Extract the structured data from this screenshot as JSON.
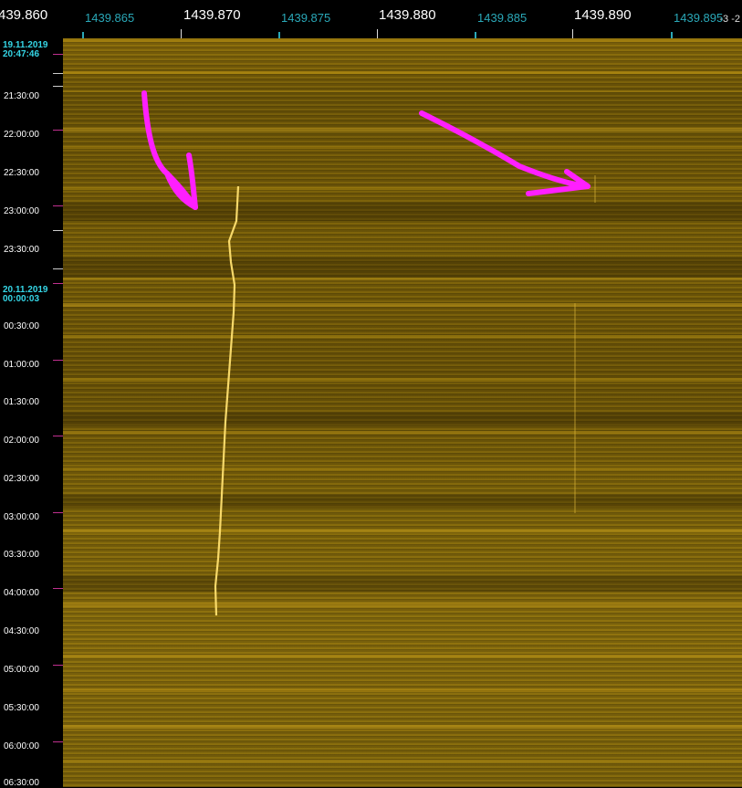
{
  "freq_axis": {
    "major_labels": [
      "439.860",
      "1439.870",
      "1439.880",
      "1439.890"
    ],
    "minor_labels": [
      "1439.865",
      "1439.875",
      "1439.885",
      "1439.895"
    ],
    "right_label": "-3  -2"
  },
  "time_axis": {
    "dates": [
      {
        "date": "19.11.2019",
        "time": "20:47:46"
      },
      {
        "date": "20.11.2019",
        "time": "00:00:03"
      }
    ],
    "times": [
      "21:30:00",
      "22:00:00",
      "22:30:00",
      "23:00:00",
      "23:30:00",
      "00:30:00",
      "01:00:00",
      "01:30:00",
      "02:00:00",
      "02:30:00",
      "03:00:00",
      "03:30:00",
      "04:00:00",
      "04:30:00",
      "05:00:00",
      "05:30:00",
      "06:00:00",
      "06:30:00"
    ]
  },
  "colors": {
    "signal": "#ffe070",
    "arrow": "#ff1fff",
    "date_text": "#35d6e6",
    "minor_freq_text": "#2aa8b8"
  },
  "icons": [
    "pink-arrow-icon"
  ]
}
